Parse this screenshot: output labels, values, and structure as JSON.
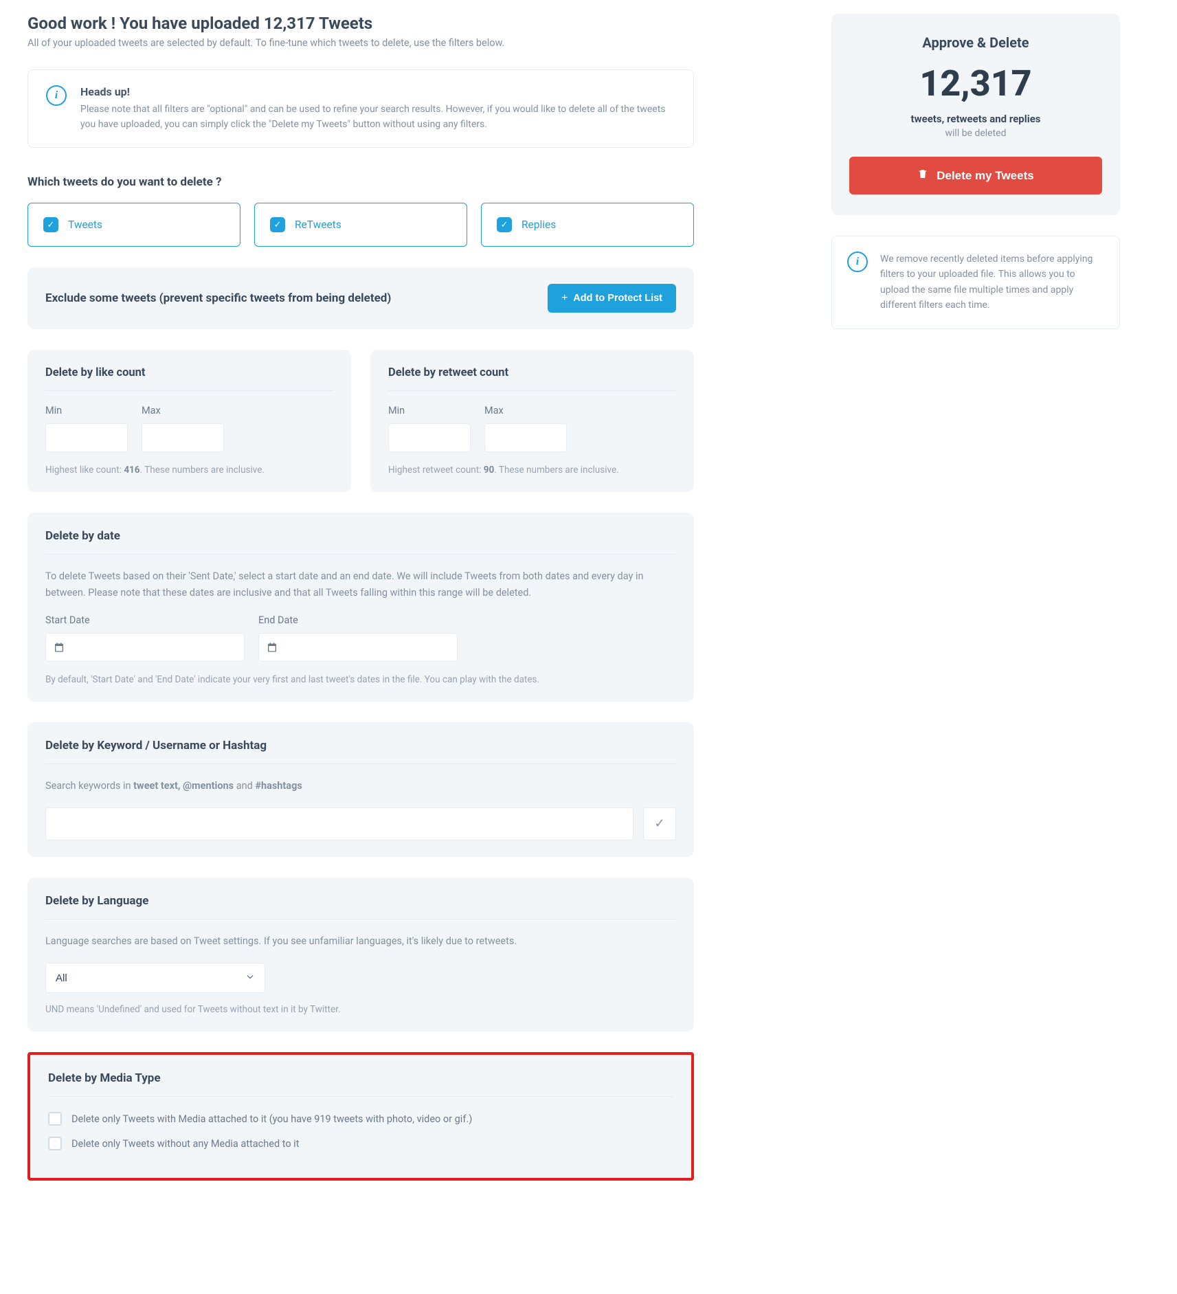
{
  "header": {
    "title": "Good work ! You have uploaded 12,317 Tweets",
    "subtitle": "All of your uploaded tweets are selected by default. To fine-tune which tweets to delete, use the filters below."
  },
  "heads_up": {
    "title": "Heads up!",
    "text": "Please note that all filters are \"optional\" and can be used to refine your search results. However, if you would like to delete all of the tweets you have uploaded, you can simply click the \"Delete my Tweets\" button without using any filters."
  },
  "which_tweets": {
    "title": "Which tweets do you want to delete ?",
    "options": [
      {
        "label": "Tweets",
        "checked": true
      },
      {
        "label": "ReTweets",
        "checked": true
      },
      {
        "label": "Replies",
        "checked": true
      }
    ]
  },
  "exclude": {
    "title": "Exclude some tweets (prevent specific tweets from being deleted)",
    "button": "Add to Protect List"
  },
  "like_count": {
    "title": "Delete by like count",
    "min_label": "Min",
    "max_label": "Max",
    "hint_pre": "Highest like count: ",
    "hint_val": "416",
    "hint_post": ". These numbers are inclusive."
  },
  "retweet_count": {
    "title": "Delete by retweet count",
    "min_label": "Min",
    "max_label": "Max",
    "hint_pre": "Highest retweet count: ",
    "hint_val": "90",
    "hint_post": ". These numbers are inclusive."
  },
  "date": {
    "title": "Delete by date",
    "desc": "To delete Tweets based on their 'Sent Date,' select a start date and an end date. We will include Tweets from both dates and every day in between. Please note that these dates are inclusive and that all Tweets falling within this range will be deleted.",
    "start_label": "Start Date",
    "end_label": "End Date",
    "hint": "By default, 'Start Date' and 'End Date' indicate your very first and last tweet's dates in the file. You can play with the dates."
  },
  "keyword": {
    "title": "Delete by Keyword / Username or Hashtag",
    "desc_pre": "Search keywords in ",
    "desc_b1": "tweet text, @mentions",
    "desc_mid": " and ",
    "desc_b2": "#hashtags"
  },
  "language": {
    "title": "Delete by Language",
    "desc": "Language searches are based on Tweet settings. If you see unfamiliar languages, it's likely due to retweets.",
    "selected": "All",
    "hint": "UND means 'Undefined' and used for Tweets without text in it by Twitter."
  },
  "media": {
    "title": "Delete by Media Type",
    "opt1": "Delete only Tweets with Media attached to it (you have 919 tweets with photo, video or gif.)",
    "opt2": "Delete only Tweets without any Media attached to it"
  },
  "approve": {
    "heading": "Approve & Delete",
    "count": "12,317",
    "sub1": "tweets, retweets and replies",
    "sub2": "will be deleted",
    "button": "Delete my Tweets"
  },
  "side_note": {
    "text": "We remove recently deleted items before applying filters to your uploaded file. This allows you to upload the same file multiple times and apply different filters each time."
  }
}
